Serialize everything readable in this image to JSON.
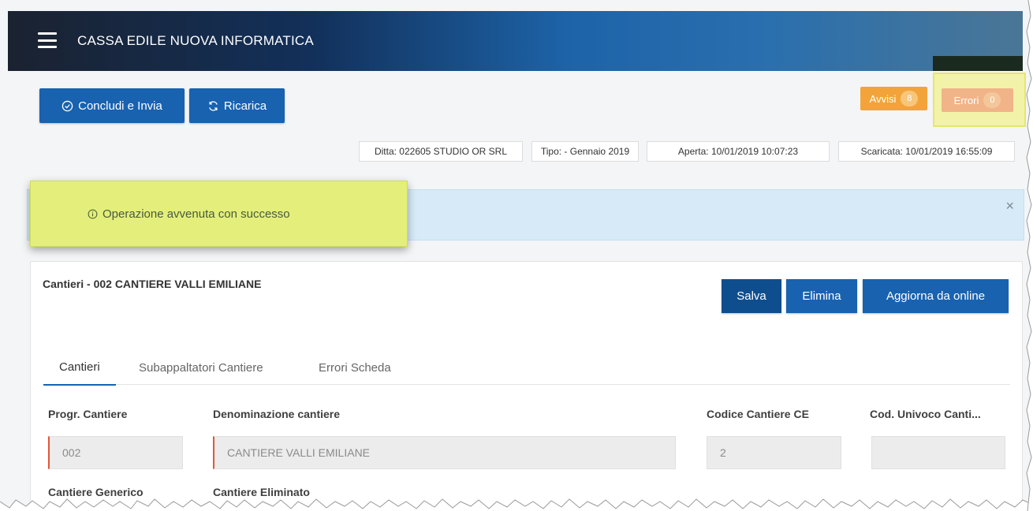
{
  "header": {
    "menu_icon": "hamburger-menu-icon",
    "title": "CASSA EDILE NUOVA INFORMATICA"
  },
  "toolbar": {
    "concludi_label": "Concludi e Invia",
    "concludi_icon": "check-circle-icon",
    "ricarica_label": "Ricarica",
    "ricarica_icon": "refresh-icon",
    "avvisi_label": "Avvisi",
    "avvisi_count": "8",
    "errori_label": "Errori",
    "errori_count": "0"
  },
  "info_chips": {
    "ditta": "Ditta: 022605 STUDIO OR SRL",
    "tipo": "Tipo: - Gennaio 2019",
    "aperta": "Aperta: 10/01/2019 10:07:23",
    "scaricata": "Scaricata: 10/01/2019 16:55:09"
  },
  "alert": {
    "message": "Operazione avvenuta con successo",
    "icon": "info-circle-icon",
    "close": "×"
  },
  "card": {
    "title": "Cantieri - 002 CANTIERE VALLI EMILIANE",
    "buttons": {
      "salva": "Salva",
      "elimina": "Elimina",
      "aggiorna": "Aggiorna da online"
    },
    "tabs": [
      "Cantieri",
      "Subappaltatori Cantiere",
      "Errori Scheda"
    ],
    "fields": {
      "progr_label": "Progr. Cantiere",
      "progr_value": "002",
      "denominazione_label": "Denominazione cantiere",
      "denominazione_value": "CANTIERE VALLI EMILIANE",
      "codice_label": "Codice Cantiere CE",
      "codice_value": "2",
      "univoco_label": "Cod. Univoco Canti...",
      "univoco_value": "",
      "generico_label": "Cantiere Generico",
      "eliminato_label": "Cantiere Eliminato"
    }
  },
  "colors": {
    "primary": "#1862b0",
    "avvisi": "#f2a43a",
    "errori": "#f1b489",
    "toast_highlight": "#e3ef7a",
    "alert_bg": "#d6ebf7"
  }
}
